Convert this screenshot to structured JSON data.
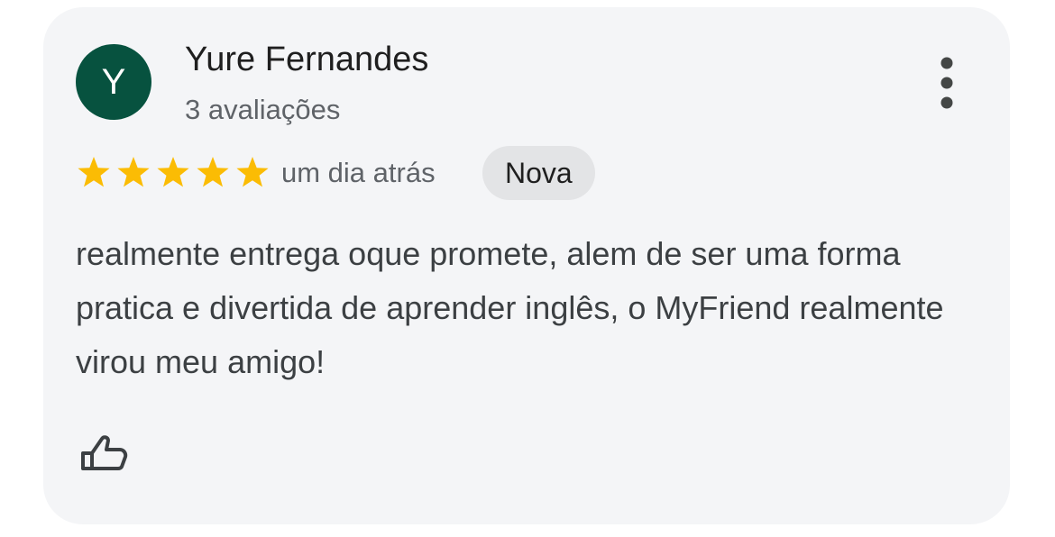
{
  "review": {
    "avatar_initial": "Y",
    "author_name": "Yure Fernandes",
    "review_count": "3 avaliações",
    "rating": 5,
    "rating_max": 5,
    "time_ago": "um dia atrás",
    "badge": "Nova",
    "text": "realmente entrega oque promete, alem de ser uma forma pratica e divertida de aprender inglês, o MyFriend realmente virou meu amigo!"
  },
  "icons": {
    "more": "more-vert-icon",
    "like": "thumb-up-icon",
    "star": "star-icon"
  },
  "colors": {
    "avatar_bg": "#07523f",
    "star": "#fbbc04",
    "card_bg": "#f4f5f7",
    "badge_bg": "#e3e4e6"
  }
}
